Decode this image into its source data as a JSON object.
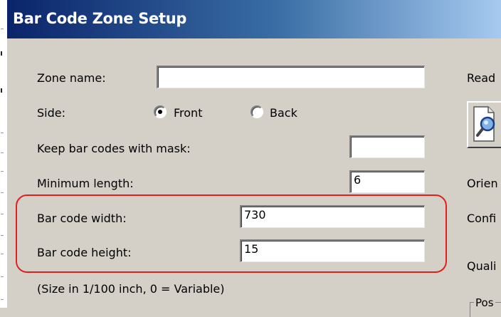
{
  "window": {
    "title": "Bar Code Zone Setup"
  },
  "form": {
    "zone_name": {
      "label": "Zone name:",
      "value": ""
    },
    "side": {
      "label": "Side:",
      "options": [
        {
          "label": "Front",
          "selected": true
        },
        {
          "label": "Back",
          "selected": false
        }
      ]
    },
    "mask": {
      "label": "Keep bar codes with mask:",
      "value": ""
    },
    "min_length": {
      "label": "Minimum length:",
      "value": "6"
    },
    "width": {
      "label": "Bar code width:",
      "value": "730"
    },
    "height": {
      "label": "Bar code height:",
      "value": "15"
    },
    "size_note": "(Size in 1/100 inch, 0 = Variable)"
  },
  "right_panel": {
    "read_label": "Read",
    "orientation_label": "Orien",
    "confidence_label": "Confi",
    "quality_label": "Quali",
    "pos_label": "Pos"
  },
  "annotation": {
    "highlight_color": "#e0201c"
  },
  "colors": {
    "titlebar_start": "#0a246a",
    "dialog_bg": "#d4d0c8"
  },
  "icons": {
    "read_icon": "magnifier-document-icon"
  }
}
